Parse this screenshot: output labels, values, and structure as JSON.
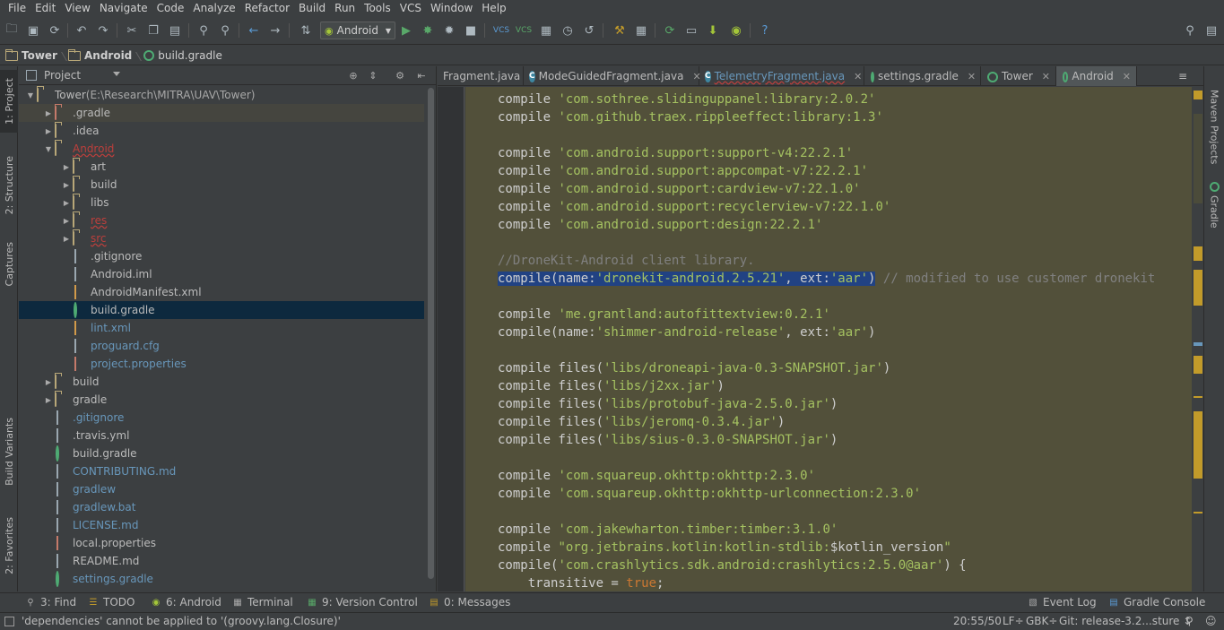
{
  "menu": [
    "File",
    "Edit",
    "View",
    "Navigate",
    "Code",
    "Analyze",
    "Refactor",
    "Build",
    "Run",
    "Tools",
    "VCS",
    "Window",
    "Help"
  ],
  "toolbar": {
    "run_config": "Android"
  },
  "breadcrumbs": [
    "Tower",
    "Android",
    "build.gradle"
  ],
  "left_stripe": {
    "project": "1: Project",
    "structure": "2: Structure",
    "captures": "Captures",
    "build_variants": "Build Variants",
    "favorites": "2: Favorites"
  },
  "right_stripe": {
    "maven": "Maven Projects",
    "gradle": "Gradle"
  },
  "project_panel": {
    "title": "Project",
    "tree": [
      {
        "label": "Tower",
        "suffix": " (E:\\Research\\MITRA\\UAV\\Tower)",
        "depth": 0,
        "expanded": true,
        "icon": "module"
      },
      {
        "label": ".gradle",
        "depth": 1,
        "expandable": true,
        "icon": "folder-red"
      },
      {
        "label": ".idea",
        "depth": 1,
        "expandable": true,
        "icon": "folder"
      },
      {
        "label": "Android",
        "depth": 1,
        "expanded": true,
        "icon": "module",
        "style": "red"
      },
      {
        "label": "art",
        "depth": 2,
        "expandable": true,
        "icon": "folder"
      },
      {
        "label": "build",
        "depth": 2,
        "expandable": true,
        "icon": "folder"
      },
      {
        "label": "libs",
        "depth": 2,
        "expandable": true,
        "icon": "folder"
      },
      {
        "label": "res",
        "depth": 2,
        "expandable": true,
        "icon": "folder",
        "style": "red"
      },
      {
        "label": "src",
        "depth": 2,
        "expandable": true,
        "icon": "folder",
        "style": "red"
      },
      {
        "label": ".gitignore",
        "depth": 2,
        "icon": "file"
      },
      {
        "label": "Android.iml",
        "depth": 2,
        "icon": "file"
      },
      {
        "label": "AndroidManifest.xml",
        "depth": 2,
        "icon": "xml"
      },
      {
        "label": "build.gradle",
        "depth": 2,
        "icon": "gradle",
        "selected": true
      },
      {
        "label": "lint.xml",
        "depth": 2,
        "icon": "xml",
        "style": "blue"
      },
      {
        "label": "proguard.cfg",
        "depth": 2,
        "icon": "file",
        "style": "blue"
      },
      {
        "label": "project.properties",
        "depth": 2,
        "icon": "props",
        "style": "blue"
      },
      {
        "label": "build",
        "depth": 1,
        "expandable": true,
        "icon": "folder"
      },
      {
        "label": "gradle",
        "depth": 1,
        "expandable": true,
        "icon": "folder"
      },
      {
        "label": ".gitignore",
        "depth": 1,
        "icon": "file",
        "style": "blue"
      },
      {
        "label": ".travis.yml",
        "depth": 1,
        "icon": "file"
      },
      {
        "label": "build.gradle",
        "depth": 1,
        "icon": "gradle"
      },
      {
        "label": "CONTRIBUTING.md",
        "depth": 1,
        "icon": "file",
        "style": "blue"
      },
      {
        "label": "gradlew",
        "depth": 1,
        "icon": "file",
        "style": "blue"
      },
      {
        "label": "gradlew.bat",
        "depth": 1,
        "icon": "file",
        "style": "blue"
      },
      {
        "label": "LICENSE.md",
        "depth": 1,
        "icon": "file",
        "style": "blue"
      },
      {
        "label": "local.properties",
        "depth": 1,
        "icon": "props"
      },
      {
        "label": "README.md",
        "depth": 1,
        "icon": "file"
      },
      {
        "label": "settings.gradle",
        "depth": 1,
        "icon": "gradle",
        "style": "blue"
      }
    ]
  },
  "editor_tabs": [
    {
      "label": "Fragment.java",
      "icon": "none"
    },
    {
      "label": "ModeGuidedFragment.java",
      "icon": "class"
    },
    {
      "label": "TelemetryFragment.java",
      "icon": "class",
      "style": "blue-underline"
    },
    {
      "label": "settings.gradle",
      "icon": "gradle"
    },
    {
      "label": "Tower",
      "icon": "gradle"
    },
    {
      "label": "Android",
      "icon": "gradle",
      "active": true
    }
  ],
  "code_lines": [
    [
      [
        "kw",
        "compile "
      ],
      [
        "str",
        "'com.sothree.slidinguppanel:library:2.0.2'"
      ]
    ],
    [
      [
        "kw",
        "compile "
      ],
      [
        "str",
        "'com.github.traex.rippleeffect:library:1.3'"
      ]
    ],
    [],
    [
      [
        "kw",
        "compile "
      ],
      [
        "str",
        "'com.android.support:support-v4:22.2.1'"
      ]
    ],
    [
      [
        "kw",
        "compile "
      ],
      [
        "str",
        "'com.android.support:appcompat-v7:22.2.1'"
      ]
    ],
    [
      [
        "kw",
        "compile "
      ],
      [
        "str",
        "'com.android.support:cardview-v7:22.1.0'"
      ]
    ],
    [
      [
        "kw",
        "compile "
      ],
      [
        "str",
        "'com.android.support:recyclerview-v7:22.1.0'"
      ]
    ],
    [
      [
        "kw",
        "compile "
      ],
      [
        "str",
        "'com.android.support:design:22.2.1'"
      ]
    ],
    [],
    [
      [
        "cmt",
        "//DroneKit-Android client library."
      ]
    ],
    [
      [
        "sel",
        "compile(name:"
      ],
      [
        "selstr",
        "'dronekit-android.2.5.21'"
      ],
      [
        "sel",
        ", ext:"
      ],
      [
        "selstr",
        "'aar'"
      ],
      [
        "sel",
        ")"
      ],
      [
        "cmt",
        " // modified to use customer dronekit"
      ]
    ],
    [],
    [
      [
        "kw",
        "compile "
      ],
      [
        "str",
        "'me.grantland:autofittextview:0.2.1'"
      ]
    ],
    [
      [
        "kw",
        "compile(name:"
      ],
      [
        "str",
        "'shimmer-android-release'"
      ],
      [
        "kw",
        ", ext:"
      ],
      [
        "str",
        "'aar'"
      ],
      [
        "kw",
        ")"
      ]
    ],
    [],
    [
      [
        "kw",
        "compile files("
      ],
      [
        "str",
        "'libs/droneapi-java-0.3-SNAPSHOT.jar'"
      ],
      [
        "kw",
        ")"
      ]
    ],
    [
      [
        "kw",
        "compile files("
      ],
      [
        "str",
        "'libs/j2xx.jar'"
      ],
      [
        "kw",
        ")"
      ]
    ],
    [
      [
        "kw",
        "compile files("
      ],
      [
        "str",
        "'libs/protobuf-java-2.5.0.jar'"
      ],
      [
        "kw",
        ")"
      ]
    ],
    [
      [
        "kw",
        "compile files("
      ],
      [
        "str",
        "'libs/jeromq-0.3.4.jar'"
      ],
      [
        "kw",
        ")"
      ]
    ],
    [
      [
        "kw",
        "compile files("
      ],
      [
        "str",
        "'libs/sius-0.3.0-SNAPSHOT.jar'"
      ],
      [
        "kw",
        ")"
      ]
    ],
    [],
    [
      [
        "kw",
        "compile "
      ],
      [
        "str",
        "'com.squareup.okhttp:okhttp:2.3.0'"
      ]
    ],
    [
      [
        "kw",
        "compile "
      ],
      [
        "str",
        "'com.squareup.okhttp:okhttp-urlconnection:2.3.0'"
      ]
    ],
    [],
    [
      [
        "kw",
        "compile "
      ],
      [
        "str",
        "'com.jakewharton.timber:timber:3.1.0'"
      ]
    ],
    [
      [
        "kw",
        "compile "
      ],
      [
        "str",
        "\"org.jetbrains.kotlin:kotlin-stdlib:"
      ],
      [
        "kw",
        "$kotlin_version"
      ],
      [
        "str",
        "\""
      ]
    ],
    [
      [
        "kw",
        "compile("
      ],
      [
        "str",
        "'com.crashlytics.sdk.android:crashlytics:2.5.0@aar'"
      ],
      [
        "kw",
        ") {"
      ]
    ],
    [
      [
        "kw",
        "    transitive = "
      ],
      [
        "bool",
        "true"
      ],
      [
        "kw",
        ";"
      ]
    ]
  ],
  "bottom_tabs": {
    "find": "3: Find",
    "todo": "TODO",
    "android": "6: Android",
    "terminal": "Terminal",
    "version_control": "9: Version Control",
    "messages": "0: Messages",
    "event_log": "Event Log",
    "gradle_console": "Gradle Console"
  },
  "status": {
    "message": "'dependencies' cannot be applied to '(groovy.lang.Closure)'",
    "position": "20:55/50",
    "line_sep": "LF÷",
    "encoding": "GBK÷",
    "git": "Git: release-3.2...sture ↕"
  },
  "colors": {
    "background": "#3c3f41",
    "editor_bg": "#52503a",
    "selection": "#214283",
    "string": "#a5c261",
    "comment": "#808080"
  }
}
